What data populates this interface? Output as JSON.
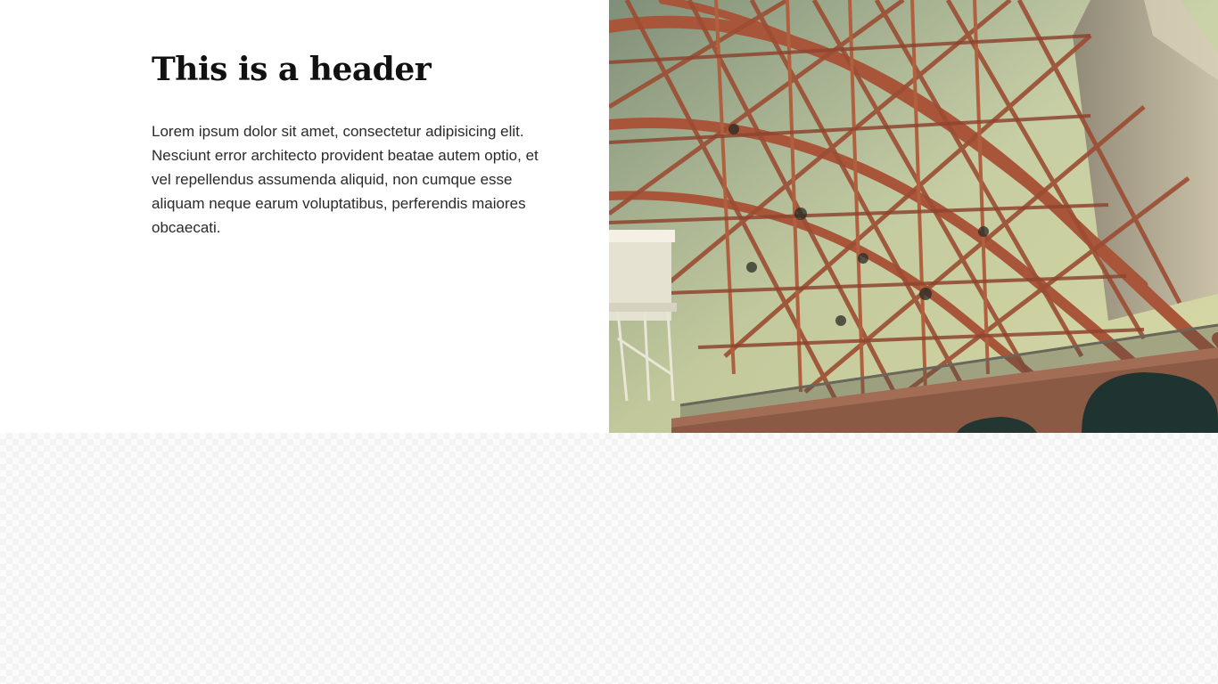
{
  "hero": {
    "header": "This is a header",
    "body": "Lorem ipsum dolor sit amet, consectetur adipisicing elit. Nesciunt error architecto provident beatae autem optio, et vel repellendus assumenda aliquid, non cumque esse aliquam neque earum voluptatibus, perferendis maiores obcaecati."
  },
  "colors": {
    "background": "#ffffff",
    "text": "#111111",
    "steel": "#a8553a",
    "brick": "#8a5a45",
    "sky": "#eef2c2"
  }
}
